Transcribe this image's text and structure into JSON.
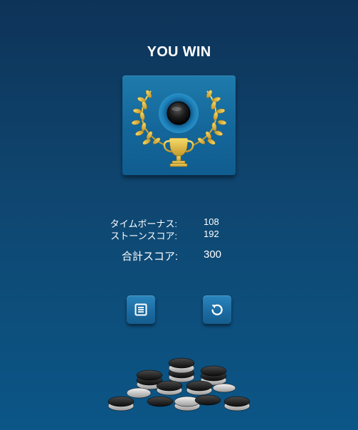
{
  "result": {
    "title": "YOU WIN"
  },
  "scores": [
    {
      "label": "タイムボーナス:",
      "value": "108"
    },
    {
      "label": "ストーンスコア:",
      "value": "192"
    }
  ],
  "total": {
    "label": "合計スコア:",
    "value": "300"
  },
  "buttons": [
    {
      "name": "menu-button",
      "icon": "menu-list-icon"
    },
    {
      "name": "retry-button",
      "icon": "restart-icon"
    }
  ],
  "colors": {
    "accent_gold": "#d8b63a",
    "badge_blue": "#16699c",
    "background_top": "#0e3358",
    "background_bottom": "#0b5687"
  }
}
